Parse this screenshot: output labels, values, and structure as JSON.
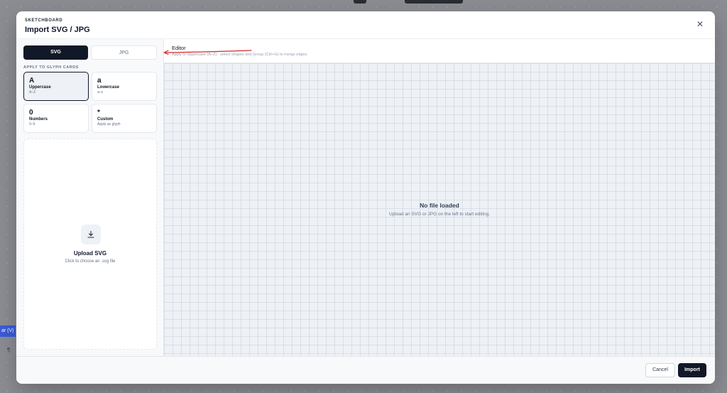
{
  "background": {
    "side_tab_label": "ar (V)",
    "side_glyph": "¶"
  },
  "modal": {
    "kicker": "SKETCHBOARD",
    "title": "Import SVG / JPG",
    "close_icon": "close-icon"
  },
  "left_panel": {
    "format_tabs": [
      {
        "label": "SVG",
        "active": true
      },
      {
        "label": "JPG",
        "active": false
      }
    ],
    "section_label": "APPLY TO GLYPH CARDS",
    "glyph_cards": [
      {
        "char": "A",
        "name": "Uppercase",
        "sub": "A–Z",
        "active": true
      },
      {
        "char": "a",
        "name": "Lowercase",
        "sub": "a–z",
        "active": false
      },
      {
        "char": "0",
        "name": "Numbers",
        "sub": "0–9",
        "active": false
      },
      {
        "char": "*",
        "name": "Custom",
        "sub": "Apply as glyph",
        "active": false
      }
    ],
    "upload": {
      "icon": "download-icon",
      "title": "Upload SVG",
      "subtitle": "Click to choose an .svg file"
    }
  },
  "editor": {
    "title": "Editor",
    "hint": "Apply to Uppercase (A–Z) · select shapes and Group (Ctrl+G) to merge edges",
    "empty_title": "No file loaded",
    "empty_subtitle": "Upload an SVG or JPG on the left to start editing."
  },
  "footer": {
    "cancel_label": "Cancel",
    "import_label": "Import"
  },
  "colors": {
    "primary": "#111827",
    "annotation_arrow": "#d62828",
    "canvas_bg": "#eef1f5"
  }
}
